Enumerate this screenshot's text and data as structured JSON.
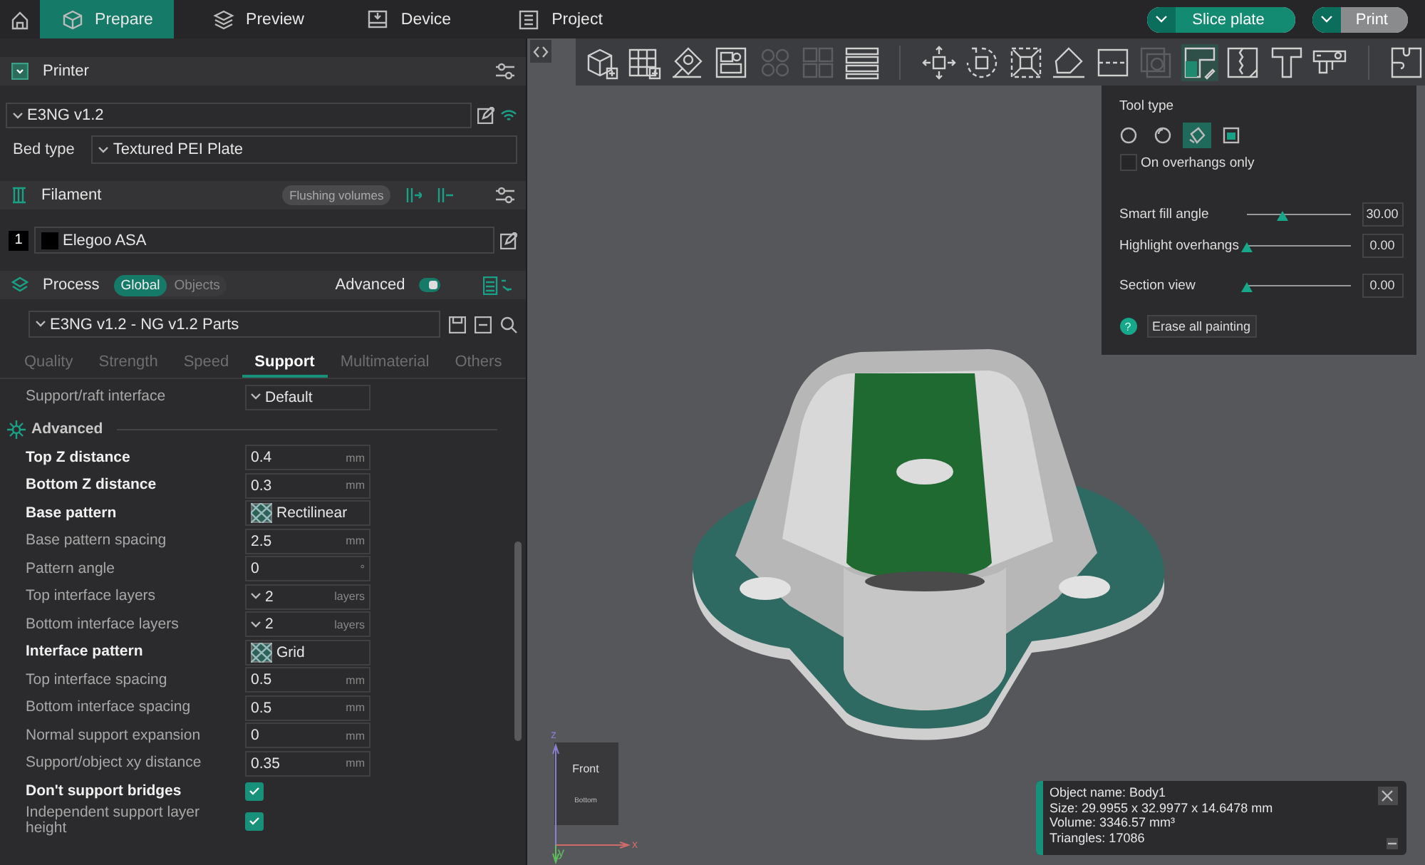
{
  "top_bar": {
    "tabs": [
      {
        "label": "Prepare",
        "selected": true,
        "kind": "cube"
      },
      {
        "label": "Preview",
        "selected": false,
        "kind": "layers"
      },
      {
        "label": "Device",
        "selected": false,
        "kind": "device"
      },
      {
        "label": "Project",
        "selected": false,
        "kind": "list"
      }
    ],
    "actions": [
      {
        "label": "Slice plate",
        "kind": "primary"
      },
      {
        "label": "Print",
        "kind": "secondary"
      }
    ]
  },
  "printer": {
    "title": "Printer",
    "preset": "E3NG v1.2",
    "bed_type_label": "Bed type",
    "bed_type": "Textured PEI Plate"
  },
  "filament": {
    "title": "Filament",
    "flushing_button": "Flushing volumes",
    "items": [
      {
        "index": "1",
        "name": "Elegoo ASA",
        "color": "#000000"
      }
    ]
  },
  "process": {
    "title": "Process",
    "scope": [
      {
        "label": "Global",
        "selected": true
      },
      {
        "label": "Objects",
        "selected": false
      }
    ],
    "advanced_label": "Advanced",
    "advanced_on": true,
    "preset": "E3NG v1.2 - NG v1.2 Parts",
    "tabs": [
      {
        "label": "Quality",
        "selected": false
      },
      {
        "label": "Strength",
        "selected": false
      },
      {
        "label": "Speed",
        "selected": false
      },
      {
        "label": "Support",
        "selected": true
      },
      {
        "label": "Multimaterial",
        "selected": false
      },
      {
        "label": "Others",
        "selected": false
      }
    ],
    "settings": [
      {
        "kind": "combo",
        "label": "Support/raft interface",
        "value": "Default",
        "highlighted": false
      },
      {
        "kind": "group",
        "label": "Advanced"
      },
      {
        "kind": "number",
        "label": "Top Z distance",
        "value": "0.4",
        "unit": "mm",
        "highlighted": true
      },
      {
        "kind": "number",
        "label": "Bottom Z distance",
        "value": "0.3",
        "unit": "mm",
        "highlighted": true
      },
      {
        "kind": "pattern",
        "label": "Base pattern",
        "value": "Rectilinear",
        "highlighted": true
      },
      {
        "kind": "number",
        "label": "Base pattern spacing",
        "value": "2.5",
        "unit": "mm",
        "highlighted": false
      },
      {
        "kind": "number",
        "label": "Pattern angle",
        "value": "0",
        "unit": "°",
        "highlighted": false
      },
      {
        "kind": "combo",
        "label": "Top interface layers",
        "value": "2",
        "unit": "layers",
        "highlighted": false
      },
      {
        "kind": "combo",
        "label": "Bottom interface layers",
        "value": "2",
        "unit": "layers",
        "highlighted": false
      },
      {
        "kind": "pattern",
        "label": "Interface pattern",
        "value": "Grid",
        "highlighted": true
      },
      {
        "kind": "number",
        "label": "Top interface spacing",
        "value": "0.5",
        "unit": "mm",
        "highlighted": false
      },
      {
        "kind": "number",
        "label": "Bottom interface spacing",
        "value": "0.5",
        "unit": "mm",
        "highlighted": false
      },
      {
        "kind": "number",
        "label": "Normal support expansion",
        "value": "0",
        "unit": "mm",
        "highlighted": false
      },
      {
        "kind": "number",
        "label": "Support/object xy distance",
        "value": "0.35",
        "unit": "mm",
        "highlighted": false
      },
      {
        "kind": "checkbox",
        "label": "Don't support bridges",
        "checked": true,
        "highlighted": true
      },
      {
        "kind": "checkbox",
        "label": "Independent support layer height",
        "checked": true,
        "highlighted": false
      }
    ]
  },
  "viewport": {
    "toolbar": [
      {
        "kind": "add-cube",
        "disabled": false,
        "selected": false
      },
      {
        "kind": "add-grid",
        "disabled": false,
        "selected": false
      },
      {
        "kind": "orient",
        "disabled": false,
        "selected": false
      },
      {
        "kind": "arrange",
        "disabled": false,
        "selected": false
      },
      {
        "kind": "circles",
        "disabled": true,
        "selected": false
      },
      {
        "kind": "squares",
        "disabled": true,
        "selected": false
      },
      {
        "kind": "lines",
        "disabled": false,
        "selected": false
      },
      {
        "kind": "separator"
      },
      {
        "kind": "move",
        "disabled": false,
        "selected": false
      },
      {
        "kind": "rotate",
        "disabled": false,
        "selected": false
      },
      {
        "kind": "scale",
        "disabled": false,
        "selected": false
      },
      {
        "kind": "lay-face",
        "disabled": false,
        "selected": false
      },
      {
        "kind": "cut",
        "disabled": false,
        "selected": false
      },
      {
        "kind": "boolean",
        "disabled": true,
        "selected": false
      },
      {
        "kind": "support-paint",
        "disabled": false,
        "selected": true
      },
      {
        "kind": "seam-paint",
        "disabled": false,
        "selected": false
      },
      {
        "kind": "text",
        "disabled": false,
        "selected": false
      },
      {
        "kind": "measure",
        "disabled": false,
        "selected": false
      },
      {
        "kind": "separator"
      },
      {
        "kind": "puzzle",
        "disabled": false,
        "selected": false
      }
    ],
    "tool_panel": {
      "tool_type_label": "Tool type",
      "tools": [
        {
          "kind": "circle",
          "selected": false
        },
        {
          "kind": "sphere",
          "selected": false
        },
        {
          "kind": "fill",
          "selected": true
        },
        {
          "kind": "gap-fill",
          "selected": false
        }
      ],
      "overhangs_label": "On overhangs only",
      "overhangs_checked": false,
      "sliders": [
        {
          "label": "Smart fill angle",
          "level": 0.35,
          "reading": "30.00"
        },
        {
          "label": "Highlight overhangs",
          "level": 0.0,
          "reading": "0.00"
        },
        {
          "label": "Section view",
          "level": 0.0,
          "reading": "0.00"
        }
      ],
      "help": "?",
      "erase_button": "Erase all painting"
    },
    "gizmo": {
      "front": "Front",
      "bottom": "Bottom",
      "x": "x",
      "y": "y",
      "z": "z"
    },
    "object_info": {
      "lines": [
        "Object name: Body1",
        "Size: 29.9955 x 32.9977 x 14.6478 mm",
        "Volume: 3346.57 mm³",
        "Triangles: 17086"
      ]
    }
  }
}
